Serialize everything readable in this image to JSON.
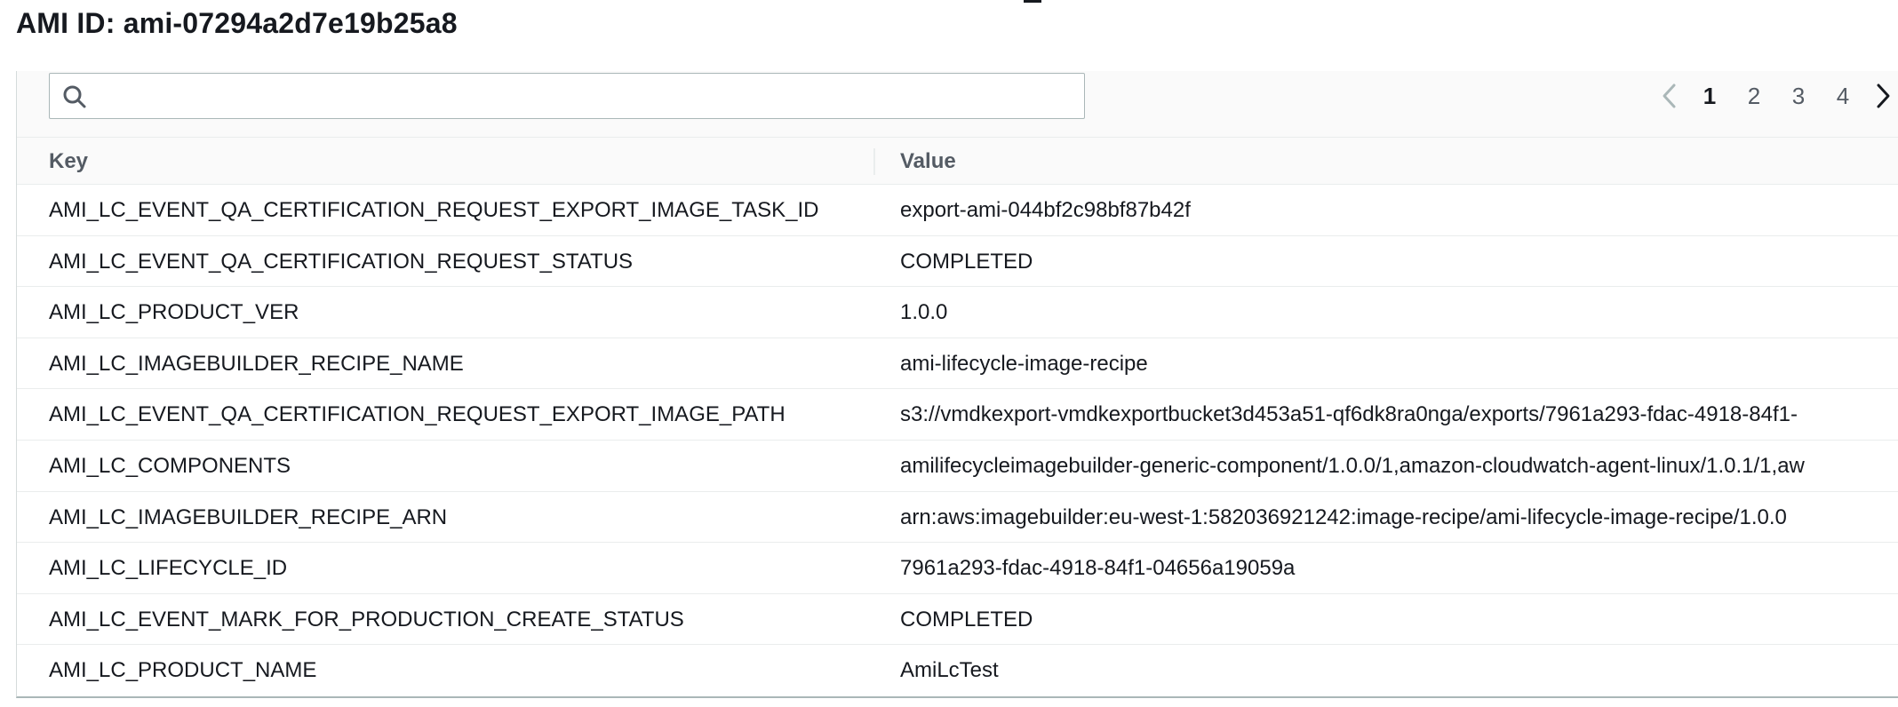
{
  "page": {
    "title": "AMI ID: ami-07294a2d7e19b25a8"
  },
  "search": {
    "value": "",
    "placeholder": ""
  },
  "pagination": {
    "pages": [
      "1",
      "2",
      "3",
      "4"
    ],
    "current": "1"
  },
  "table": {
    "headers": {
      "key": "Key",
      "value": "Value"
    },
    "rows": [
      {
        "key": "AMI_LC_EVENT_QA_CERTIFICATION_REQUEST_EXPORT_IMAGE_TASK_ID",
        "value": "export-ami-044bf2c98bf87b42f"
      },
      {
        "key": "AMI_LC_EVENT_QA_CERTIFICATION_REQUEST_STATUS",
        "value": "COMPLETED"
      },
      {
        "key": "AMI_LC_PRODUCT_VER",
        "value": "1.0.0"
      },
      {
        "key": "AMI_LC_IMAGEBUILDER_RECIPE_NAME",
        "value": "ami-lifecycle-image-recipe"
      },
      {
        "key": "AMI_LC_EVENT_QA_CERTIFICATION_REQUEST_EXPORT_IMAGE_PATH",
        "value": "s3://vmdkexport-vmdkexportbucket3d453a51-qf6dk8ra0nga/exports/7961a293-fdac-4918-84f1-"
      },
      {
        "key": "AMI_LC_COMPONENTS",
        "value": "amilifecycleimagebuilder-generic-component/1.0.0/1,amazon-cloudwatch-agent-linux/1.0.1/1,aw"
      },
      {
        "key": "AMI_LC_IMAGEBUILDER_RECIPE_ARN",
        "value": "arn:aws:imagebuilder:eu-west-1:582036921242:image-recipe/ami-lifecycle-image-recipe/1.0.0"
      },
      {
        "key": "AMI_LC_LIFECYCLE_ID",
        "value": "7961a293-fdac-4918-84f1-04656a19059a"
      },
      {
        "key": "AMI_LC_EVENT_MARK_FOR_PRODUCTION_CREATE_STATUS",
        "value": "COMPLETED"
      },
      {
        "key": "AMI_LC_PRODUCT_NAME",
        "value": "AmiLcTest"
      }
    ]
  }
}
